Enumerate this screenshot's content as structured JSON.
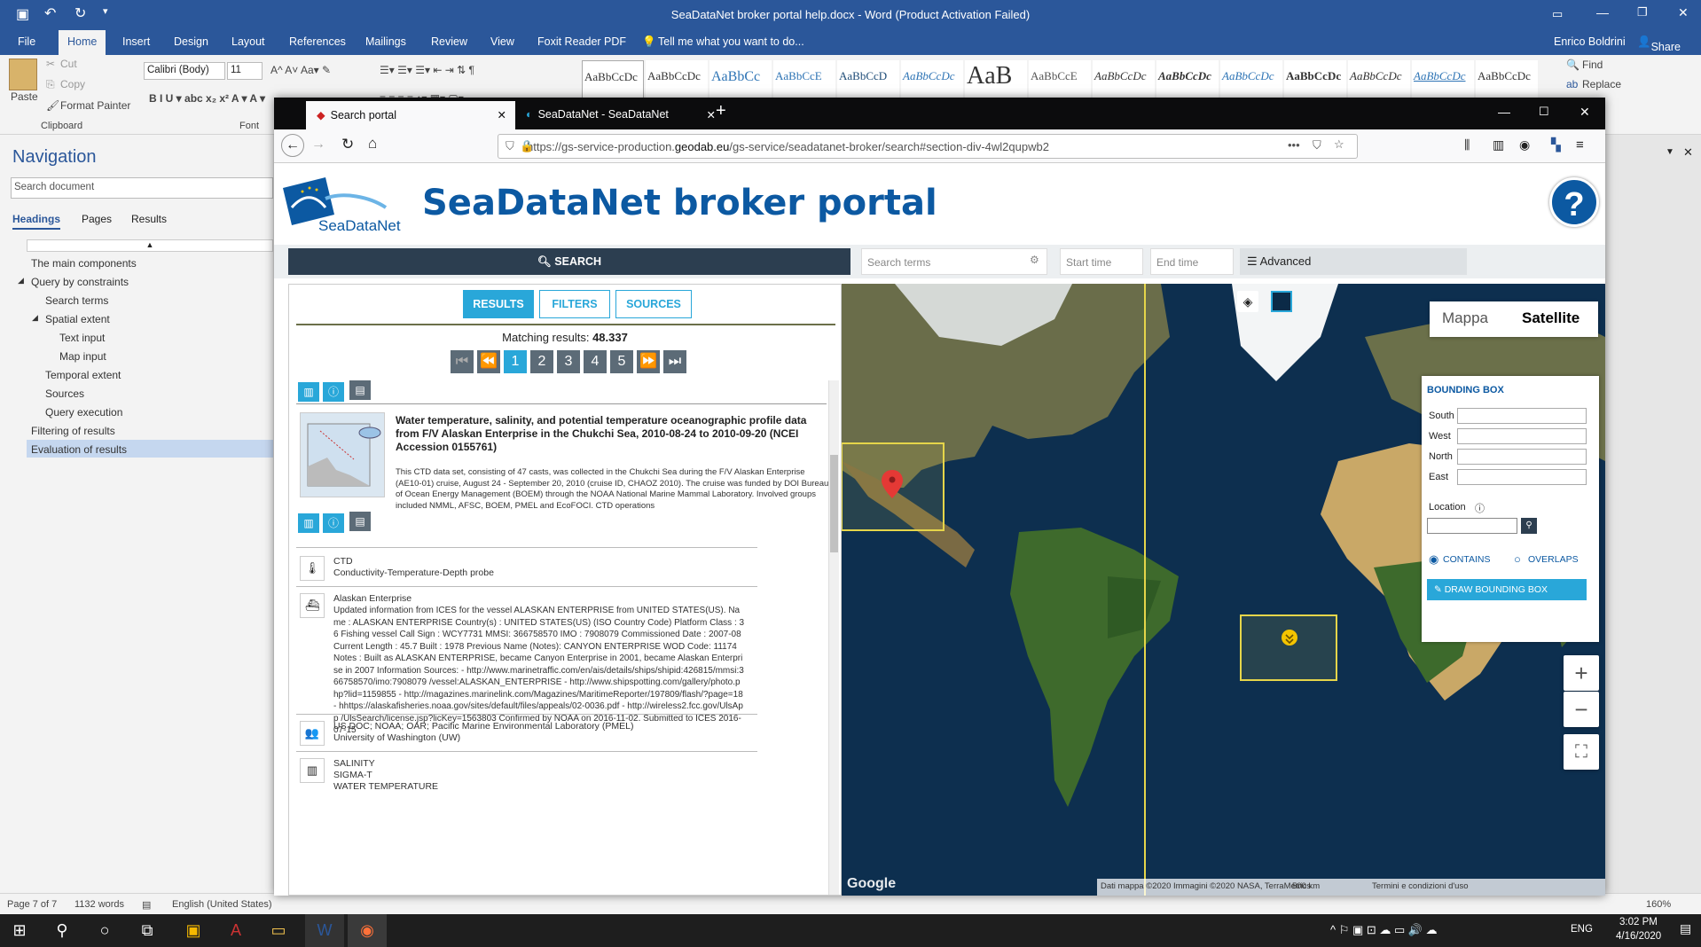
{
  "word": {
    "title": "SeaDataNet broker portal help.docx - Word (Product Activation Failed)",
    "tabs": [
      "File",
      "Home",
      "Insert",
      "Design",
      "Layout",
      "References",
      "Mailings",
      "Review",
      "View",
      "Foxit Reader PDF"
    ],
    "tell_me": "Tell me what you want to do...",
    "user": "Enrico Boldrini",
    "share": "Share",
    "clipboard": {
      "paste": "Paste",
      "cut": "Cut",
      "copy": "Copy",
      "format_painter": "Format Painter",
      "label": "Clipboard"
    },
    "font": {
      "name": "Calibri (Body)",
      "size": "11",
      "label": "Font"
    },
    "styles": [
      "AaBbCcDc",
      "AaBbCcDc",
      "AaBbCc",
      "AaBbCcE",
      "AaBbCcD",
      "AaBbCcDc",
      "AaB",
      "AaBbCcE",
      "AaBbCcDc",
      "AaBbCcDc",
      "AaBbCcDc",
      "AaBbCcDc",
      "AaBbCcDc",
      "AaBbCcDc",
      "AaBbCcDc"
    ],
    "editing": {
      "find": "Find",
      "replace": "Replace"
    },
    "navigation": {
      "title": "Navigation",
      "search_placeholder": "Search document",
      "tabs": [
        "Headings",
        "Pages",
        "Results"
      ],
      "items": [
        "The main components",
        "Query by constraints",
        "Search terms",
        "Spatial extent",
        "Text input",
        "Map input",
        "Temporal extent",
        "Sources",
        "Query execution",
        "Filtering of results",
        "Evaluation of results"
      ]
    },
    "status": {
      "page": "Page 7 of 7",
      "words": "1132 words",
      "language": "English (United States)",
      "zoom": "160%"
    }
  },
  "firefox": {
    "tabs": [
      {
        "label": "Search portal"
      },
      {
        "label": "SeaDataNet - SeaDataNet"
      }
    ],
    "url_prefix": "https://gs-service-production.",
    "url_domain": "geodab.eu",
    "url_suffix": "/gs-service/seadatanet-broker/search#section-div-4wl2qupwb2"
  },
  "portal": {
    "logo_text": "SeaDataNet",
    "title": "SeaDataNet broker portal",
    "help": "?",
    "search_button": "SEARCH",
    "search_terms_placeholder": "Search terms",
    "start_time_placeholder": "Start time",
    "end_time_placeholder": "End time",
    "advanced": "Advanced",
    "result_tabs": [
      "RESULTS",
      "FILTERS",
      "SOURCES"
    ],
    "matching_label": "Matching results:",
    "matching_count": "48.337",
    "pages": [
      "1",
      "2",
      "3",
      "4",
      "5"
    ],
    "result": {
      "title": "Water temperature, salinity, and potential temperature oceanographic profile data from F/V Alaskan Enterprise in the Chukchi Sea, 2010-08-24 to 2010-09-20 (NCEI Accession 0155761)",
      "description": "This CTD data set, consisting of 47 casts, was collected in the Chukchi Sea during the F/V Alaskan Enterprise (AE10-01) cruise, August 24 - September 20, 2010 (cruise ID, CHAOZ 2010). The cruise was funded by DOI Bureau of Ocean Energy Management (BOEM) through the NOAA National Marine Mammal Laboratory. Involved groups included NMML, AFSC, BOEM, PMEL and EcoFOCI. CTD operations",
      "instrument_code": "CTD",
      "instrument_name": "Conductivity-Temperature-Depth probe",
      "platform_name": "Alaskan Enterprise",
      "platform_desc": "Updated information from ICES for the vessel ALASKAN ENTERPRISE from UNITED STATES(US). Name : ALASKAN ENTERPRISE Country(s) : UNITED STATES(US) (ISO Country Code) Platform Class : 36 Fishing vessel Call Sign : WCY7731 MMSI: 366758570 IMO : 7908079 Commissioned Date : 2007-08 Current Length : 45.7 Built : 1978 Previous Name (Notes): CANYON ENTERPRISE WOD Code: 11174 Notes : Built as ALASKAN ENTERPRISE, became Canyon Enterprise in 2001, became Alaskan Enterprise in 2007 Information Sources: - http://www.marinetraffic.com/en/ais/details/ships/shipid:426815/mmsi:366758570/imo:7908079 /vessel:ALASKAN_ENTERPRISE - http://www.shipspotting.com/gallery/photo.php?lid=1159855 - http://magazines.marinelink.com/Magazines/MaritimeReporter/197809/flash/?page=18 - hhttps://alaskafisheries.noaa.gov/sites/default/files/appeals/02-0036.pdf - http://wireless2.fcc.gov/UlsApp /UlsSearch/license.jsp?licKey=1563803 Confirmed by NOAA on 2016-11-02. Submitted to ICES 2016-07-15",
      "organization_1": "US DOC; NOAA; OAR; Pacific Marine Environmental Laboratory (PMEL)",
      "organization_2": "University of Washington (UW)",
      "params": [
        "SALINITY",
        "SIGMA-T",
        "WATER TEMPERATURE"
      ]
    },
    "map": {
      "mappa": "Mappa",
      "satellite": "Satellite",
      "bbox_title": "BOUNDING BOX",
      "south": "South",
      "west": "West",
      "north": "North",
      "east": "East",
      "location": "Location",
      "contains": "CONTAINS",
      "overlaps": "OVERLAPS",
      "draw": "DRAW BOUNDING BOX",
      "attribution": "Dati mappa ©2020 Immagini ©2020 NASA, TerraMetrics",
      "scale": "500 km",
      "terms": "Termini e condizioni d'uso",
      "google": "Google",
      "zoom_in": "+",
      "zoom_out": "−"
    }
  },
  "taskbar": {
    "lang": "ENG",
    "time": "3:02 PM",
    "date": "4/16/2020"
  }
}
